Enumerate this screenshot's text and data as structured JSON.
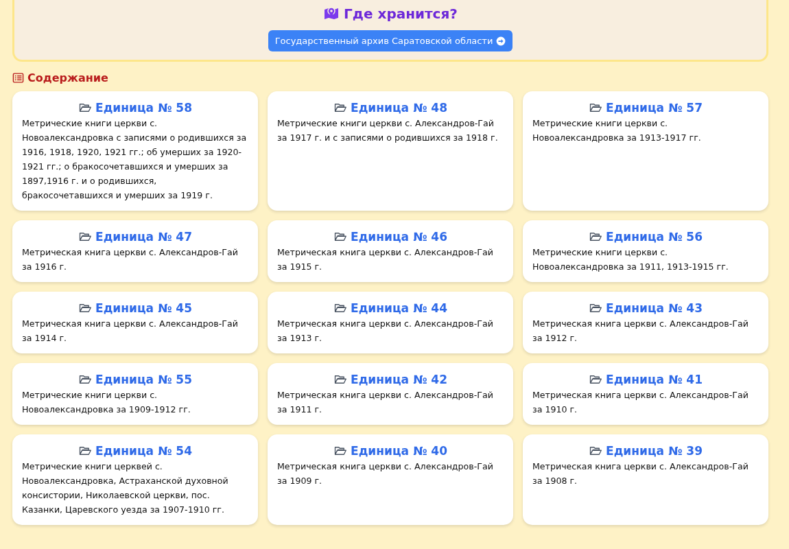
{
  "location": {
    "title": "Где хранится?",
    "archive_button": "Государственный архив Саратовской области"
  },
  "contents": {
    "heading": "Содержание",
    "units": [
      {
        "title": "Единица № 58",
        "description": "Метрические книги церкви с. Новоалександровка с записями о родившихся за 1916, 1918, 1920, 1921 гг.; об умерших за 1920-1921 гг.; о бракосочетавшихся и умерших за 1897,1916 г. и о родившихся, бракосочетавшихся и умерших за 1919 г."
      },
      {
        "title": "Единица № 48",
        "description": "Метрические книги церкви с. Александров-Гай за 1917 г. и с записями о родившихся за 1918 г."
      },
      {
        "title": "Единица № 57",
        "description": "Метрические книги церкви с. Новоалександровка за 1913-1917 гг."
      },
      {
        "title": "Единица № 47",
        "description": "Метрическая книга церкви с. Александров-Гай за 1916 г."
      },
      {
        "title": "Единица № 46",
        "description": "Метрическая книга церкви с. Александров-Гай за 1915 г."
      },
      {
        "title": "Единица № 56",
        "description": "Метрические книги церкви с. Новоалександровка за 1911, 1913-1915 гг."
      },
      {
        "title": "Единица № 45",
        "description": "Метрическая книга церкви с. Александров-Гай за 1914 г."
      },
      {
        "title": "Единица № 44",
        "description": "Метрическая книга церкви с. Александров-Гай за 1913 г."
      },
      {
        "title": "Единица № 43",
        "description": "Метрическая книга церкви с. Александров-Гай за 1912 г."
      },
      {
        "title": "Единица № 55",
        "description": "Метрические книги церкви с. Новоалександровка за 1909-1912 гг."
      },
      {
        "title": "Единица № 42",
        "description": "Метрическая книга церкви с. Александров-Гай за 1911 г."
      },
      {
        "title": "Единица № 41",
        "description": "Метрическая книга церкви с. Александров-Гай за 1910 г."
      },
      {
        "title": "Единица № 54",
        "description": "Метрические книги церквей с. Новоалександровка, Астраханской духовной консистории, Николаевской церкви, пос. Казанки, Царевского уезда за 1907-1910 гг."
      },
      {
        "title": "Единица № 40",
        "description": "Метрическая книга церкви с. Александров-Гай за 1909 г."
      },
      {
        "title": "Единица № 39",
        "description": "Метрическая книга церкви с. Александров-Гай за 1908 г."
      }
    ]
  }
}
